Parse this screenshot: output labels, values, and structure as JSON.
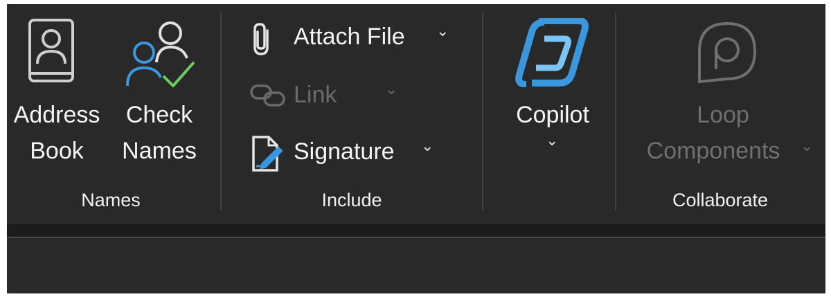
{
  "names_group": {
    "label": "Names",
    "address_book": {
      "line1": "Address",
      "line2": "Book",
      "icon": "address-book-icon"
    },
    "check_names": {
      "line1": "Check",
      "line2": "Names",
      "icon": "check-names-icon"
    }
  },
  "include_group": {
    "label": "Include",
    "attach_file": {
      "label": "Attach File",
      "icon": "paperclip-icon",
      "dropdown": "⌄"
    },
    "link": {
      "label": "Link",
      "icon": "link-icon",
      "dropdown": "⌄",
      "disabled": true
    },
    "signature": {
      "label": "Signature",
      "icon": "signature-icon",
      "dropdown": "⌄"
    }
  },
  "copilot_group": {
    "copilot": {
      "label": "Copilot",
      "icon": "copilot-icon",
      "dropdown": "⌄"
    }
  },
  "collaborate_group": {
    "label": "Collaborate",
    "loop_components": {
      "line1": "Loop",
      "line2": "Components",
      "icon": "loop-icon",
      "dropdown": "⌄",
      "disabled": true
    }
  },
  "colors": {
    "background": "#292929",
    "text": "#f5f5f5",
    "disabled_text": "#6f6f6f",
    "accent_blue": "#3a96dd",
    "check_green": "#6ccb5f"
  }
}
